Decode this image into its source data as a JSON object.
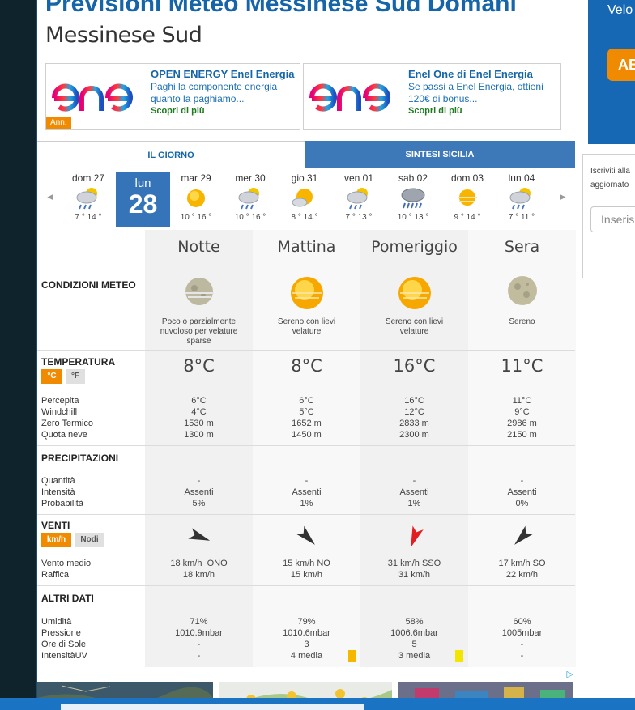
{
  "page": {
    "title": "Previsioni Meteo Messinese Sud Domani",
    "subtitle": "Messinese Sud"
  },
  "ads": [
    {
      "logo": "enel",
      "title": "OPEN ENERGY Enel Energia",
      "text": "Paghi la componente energia quanto la paghiamo...",
      "cta": "Scopri di più",
      "badge": "Ann."
    },
    {
      "logo": "enel",
      "title": "Enel One di Enel Energia",
      "text": "Se passi a Enel Energia, ottieni 120€ di bonus...",
      "cta": "Scopri di più"
    }
  ],
  "tabs": [
    {
      "label": "IL GIORNO",
      "active": true
    },
    {
      "label": "SINTESI SICILIA",
      "active": false
    }
  ],
  "days": [
    {
      "label": "dom 27",
      "temps": "7 ° 14 °",
      "icon": "cloud-rain-sun-icon"
    },
    {
      "label": "lun 28",
      "dow": "lun",
      "num": "28",
      "selected": true,
      "icon": "sun-icon"
    },
    {
      "label": "mar 29",
      "temps": "10 ° 16 °",
      "icon": "sun-icon"
    },
    {
      "label": "mer 30",
      "temps": "10 ° 16 °",
      "icon": "cloud-rain-sun-icon"
    },
    {
      "label": "gio 31",
      "temps": "8 ° 14 °",
      "icon": "sun-cloud-icon"
    },
    {
      "label": "ven 01",
      "temps": "7 ° 13 °",
      "icon": "cloud-rain-sun-icon"
    },
    {
      "label": "sab 02",
      "temps": "10 ° 13 °",
      "icon": "cloud-heavy-rain-icon"
    },
    {
      "label": "dom 03",
      "temps": "9 ° 14 °",
      "icon": "sun-haze-icon"
    },
    {
      "label": "lun 04",
      "temps": "7 ° 11 °",
      "icon": "cloud-rain-sun-icon"
    }
  ],
  "nav": {
    "prev": "◄",
    "next": "►"
  },
  "sections": {
    "conditions": "CONDIZIONI METEO",
    "temperature": "TEMPERATURA",
    "precipitation": "PRECIPITAZIONI",
    "wind": "VENTI",
    "other": "ALTRI DATI"
  },
  "units": {
    "temp_c": "°C",
    "temp_f": "°F",
    "wind_kmh": "km/h",
    "wind_knots": "Nodi"
  },
  "row_labels": {
    "temperature": [
      "Percepita",
      "Windchill",
      "Zero Termico",
      "Quota neve"
    ],
    "precipitation": [
      "Quantità",
      "Intensità",
      "Probabilità"
    ],
    "wind": [
      "Vento medio",
      "Raffica"
    ],
    "other": [
      "Umidità",
      "Pressione",
      "Ore di Sole",
      "IntensitàUV"
    ]
  },
  "periods": [
    {
      "name": "Notte",
      "icon": "moon-partly-cloudy-icon",
      "desc": "Poco o parzialmente nuvoloso per velature sparse",
      "temp": "8°C",
      "perceived": "6°C",
      "windchill": "4°C",
      "freezing": "1530 m",
      "snow": "1300 m",
      "qty": "-",
      "intensity": "Assenti",
      "probability": "5%",
      "wind_dir_deg": 110,
      "wind_color": "#333333",
      "wind_avg": "18 km/h  ONO",
      "gust": "18 km/h",
      "humidity": "71%",
      "pressure": "1010.9mbar",
      "sun_hours": "-",
      "uv": "-",
      "uv_color": ""
    },
    {
      "name": "Mattina",
      "icon": "sun-icon",
      "desc": "Sereno con lievi velature",
      "temp": "8°C",
      "perceived": "6°C",
      "windchill": "5°C",
      "freezing": "1652 m",
      "snow": "1450 m",
      "qty": "-",
      "intensity": "Assenti",
      "probability": "1%",
      "wind_dir_deg": 135,
      "wind_color": "#333333",
      "wind_avg": "15 km/h NO",
      "gust": "15 km/h",
      "humidity": "79%",
      "pressure": "1010.6mbar",
      "sun_hours": "3",
      "uv": "4 media",
      "uv_color": "#f5b800"
    },
    {
      "name": "Pomeriggio",
      "icon": "sun-icon",
      "desc": "Sereno con lievi velature",
      "temp": "16°C",
      "perceived": "16°C",
      "windchill": "12°C",
      "freezing": "2833 m",
      "snow": "2300 m",
      "qty": "-",
      "intensity": "Assenti",
      "probability": "1%",
      "wind_dir_deg": 200,
      "wind_color": "#e02020",
      "wind_avg": "31 km/h SSO",
      "gust": "31 km/h",
      "humidity": "58%",
      "pressure": "1006.6mbar",
      "sun_hours": "5",
      "uv": "3 media",
      "uv_color": "#f2e600"
    },
    {
      "name": "Sera",
      "icon": "moon-icon",
      "desc": "Sereno",
      "temp": "11°C",
      "perceived": "11°C",
      "windchill": "9°C",
      "freezing": "2986 m",
      "snow": "2150 m",
      "qty": "-",
      "intensity": "Assenti",
      "probability": "0%",
      "wind_dir_deg": 225,
      "wind_color": "#333333",
      "wind_avg": "17 km/h SO",
      "gust": "22 km/h",
      "humidity": "60%",
      "pressure": "1005mbar",
      "sun_hours": "-",
      "uv": "-",
      "uv_color": ""
    }
  ],
  "right": {
    "promo_text": "Velo",
    "promo_button": "AB",
    "newsletter_text_1": "Iscriviti alla",
    "newsletter_text_2": "aggiornato",
    "newsletter_placeholder": "Inseris"
  },
  "colors": {
    "brand_blue": "#1565a8",
    "tab_blue": "#3d78b8",
    "selected_day": "#3574b8",
    "accent_orange": "#f08a00",
    "left_bar": "#0f232c"
  }
}
